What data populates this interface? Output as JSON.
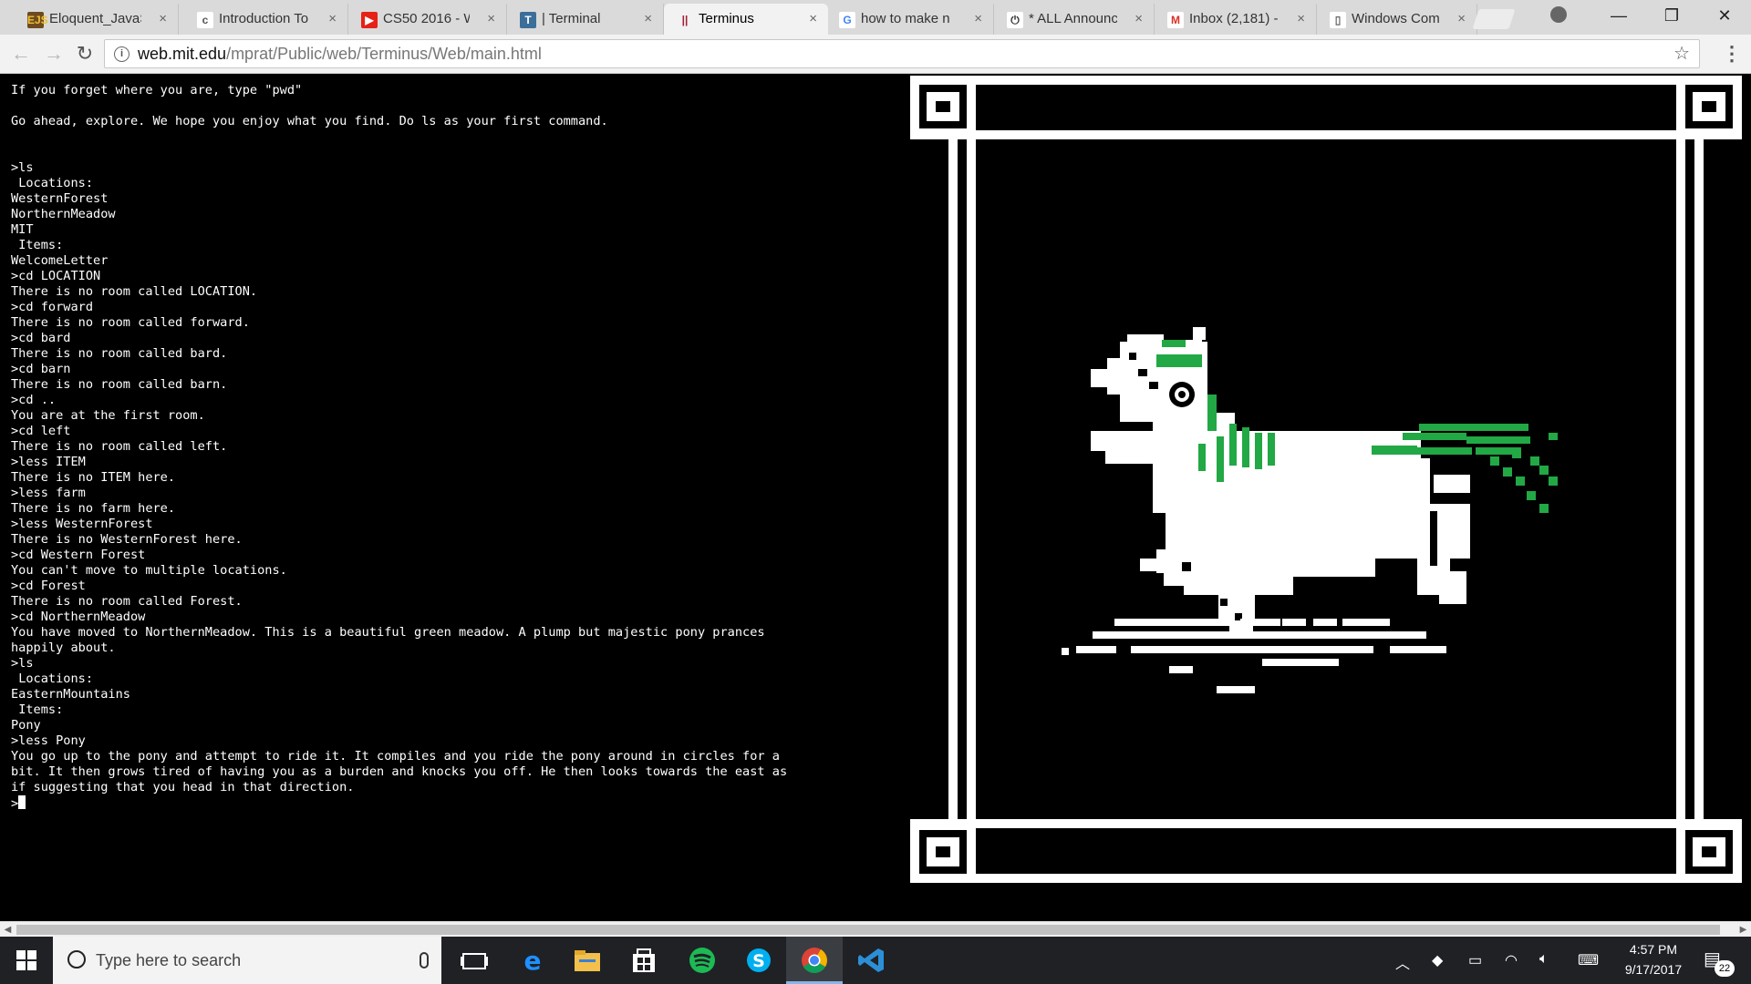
{
  "browser": {
    "tabs": [
      {
        "label": "Eloquent_JavaS",
        "favicon": "EJS",
        "favicon_color": "#f0c030",
        "favicon_bg": "#6e4b1f"
      },
      {
        "label": "Introduction To",
        "favicon": "c",
        "favicon_color": "#555555",
        "favicon_bg": "#ffffff"
      },
      {
        "label": "CS50 2016 - W",
        "favicon": "▶",
        "favicon_color": "#ffffff",
        "favicon_bg": "#e62117"
      },
      {
        "label": "| Terminal",
        "favicon": "T",
        "favicon_color": "#ffffff",
        "favicon_bg": "#3b6e99"
      },
      {
        "label": "Terminus",
        "favicon": "||",
        "favicon_color": "#a31f34",
        "favicon_bg": "#f2f2f2",
        "active": true
      },
      {
        "label": "how to make n",
        "favicon": "G",
        "favicon_color": "#4285f4",
        "favicon_bg": "#ffffff"
      },
      {
        "label": "* ALL Announc",
        "favicon": "⏻",
        "favicon_color": "#333333",
        "favicon_bg": "#ffffff"
      },
      {
        "label": "Inbox (2,181) -",
        "favicon": "M",
        "favicon_color": "#d93025",
        "favicon_bg": "#ffffff"
      },
      {
        "label": "Windows Com",
        "favicon": "▯",
        "favicon_color": "#666666",
        "favicon_bg": "#ffffff"
      }
    ],
    "tab_close_glyph": "×",
    "url_host": "web.mit.edu",
    "url_path": "/mprat/Public/web/Terminus/Web/main.html",
    "window_controls": {
      "minimize": "—",
      "maximize": "❐",
      "close": "✕"
    },
    "nav": {
      "back": "←",
      "forward": "→",
      "reload": "↻",
      "star": "☆",
      "menu": "⋮",
      "info": "i"
    }
  },
  "terminal": {
    "lines": [
      "If you forget where you are, type \"pwd\"",
      "",
      "Go ahead, explore. We hope you enjoy what you find. Do ls as your first command.",
      "",
      "",
      ">ls",
      " Locations:",
      "WesternForest",
      "NorthernMeadow",
      "MIT",
      " Items:",
      "WelcomeLetter",
      ">cd LOCATION",
      "There is no room called LOCATION.",
      ">cd forward",
      "There is no room called forward.",
      ">cd bard",
      "There is no room called bard.",
      ">cd barn",
      "There is no room called barn.",
      ">cd ..",
      "You are at the first room.",
      ">cd left",
      "There is no room called left.",
      ">less ITEM",
      "There is no ITEM here.",
      ">less farm",
      "There is no farm here.",
      ">less WesternForest",
      "There is no WesternForest here.",
      ">cd Western Forest",
      "You can't move to multiple locations.",
      ">cd Forest",
      "There is no room called Forest.",
      ">cd NorthernMeadow",
      "You have moved to NorthernMeadow. This is a beautiful green meadow. A plump but majestic pony prances\nhappily about.",
      ">ls",
      " Locations:",
      "EasternMountains",
      " Items:",
      "Pony",
      ">less Pony",
      "You go up to the pony and attempt to ride it. It compiles and you ride the pony around in circles for a\nbit. It then grows tired of having you as a burden and knocks you off. He then looks towards the east as\nif suggesting that you head in that direction."
    ],
    "prompt": ">",
    "colors": {
      "bg": "#000000",
      "fg": "#ffffff",
      "accent": "#22a845"
    }
  },
  "art": {
    "subject": "pixel-art pony in greek-key frame",
    "mane_color": "#22a845"
  },
  "taskbar": {
    "search_placeholder": "Type here to search",
    "time": "4:57 PM",
    "date": "9/17/2017",
    "notifications": "22",
    "pinned": [
      "task-view-icon",
      "edge-icon",
      "file-explorer-icon",
      "store-icon",
      "spotify-icon",
      "skype-icon",
      "chrome-icon",
      "vscode-icon"
    ]
  }
}
